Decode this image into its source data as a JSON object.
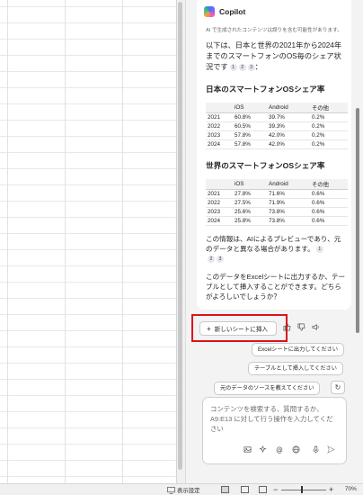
{
  "copilot": {
    "title": "Copilot",
    "disclaimer": "AI で生成されたコンテンツは誤りを含む可能性があります。",
    "intro": "以下は、日本と世界の2021年から2024年までのスマートフォンのOS毎のシェア状況です",
    "intro_cites": [
      "1",
      "2",
      "3"
    ],
    "japan": {
      "heading": "日本のスマートフォンOSシェア率",
      "headers": [
        "",
        "iOS",
        "Android",
        "その他"
      ],
      "rows": [
        [
          "2021",
          "60.8%",
          "39.7%",
          "0.2%"
        ],
        [
          "2022",
          "60.5%",
          "39.3%",
          "0.2%"
        ],
        [
          "2023",
          "57.8%",
          "42.0%",
          "0.2%"
        ],
        [
          "2024",
          "57.8%",
          "42.0%",
          "0.2%"
        ]
      ]
    },
    "world": {
      "heading": "世界のスマートフォンOSシェア率",
      "headers": [
        "",
        "iOS",
        "Android",
        "その他"
      ],
      "rows": [
        [
          "2021",
          "27.8%",
          "71.6%",
          "0.6%"
        ],
        [
          "2022",
          "27.5%",
          "71.9%",
          "0.6%"
        ],
        [
          "2023",
          "25.6%",
          "73.8%",
          "0.6%"
        ],
        [
          "2024",
          "25.8%",
          "73.8%",
          "0.6%"
        ]
      ]
    },
    "preview_note": "この情報は、AIによるプレビューであり、元のデータと異なる場合があります。",
    "preview_cites": [
      "1",
      "2",
      "3"
    ],
    "export_question": "このデータをExcelシートに出力するか、テーブルとして挿入することができます。どちらがよろしいでしょうか？",
    "more_refs": "+3",
    "insert_button": "新しいシートに挿入",
    "suggestions": [
      "Excelシートに出力してください",
      "テーブルとして挿入してください",
      "元のデータのソースを教えてください"
    ],
    "composer_placeholder": "コンテンツを検索する、質問するか、A9:E13 に対して行う操作を入力してください"
  },
  "statusbar": {
    "display_settings": "表示設定",
    "zoom": "70%"
  },
  "colors": {
    "highlight": "#e0101a",
    "pane_bg": "#f3f3f3"
  }
}
